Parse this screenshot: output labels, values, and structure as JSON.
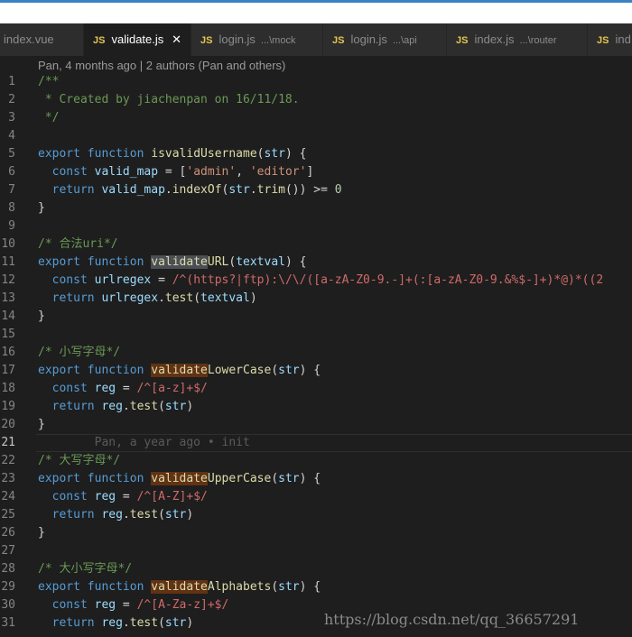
{
  "tabs": [
    {
      "name": "index.vue",
      "badge": "",
      "desc": "",
      "active": false,
      "closable": false
    },
    {
      "name": "validate.js",
      "badge": "JS",
      "desc": "",
      "active": true,
      "closable": true
    },
    {
      "name": "login.js",
      "badge": "JS",
      "desc": "...\\mock",
      "active": false,
      "closable": false
    },
    {
      "name": "login.js",
      "badge": "JS",
      "desc": "...\\api",
      "active": false,
      "closable": false
    },
    {
      "name": "index.js",
      "badge": "JS",
      "desc": "...\\router",
      "active": false,
      "closable": false
    },
    {
      "name": "ind",
      "badge": "JS",
      "desc": "",
      "active": false,
      "closable": false
    }
  ],
  "close_glyph": "✕",
  "blame": "Pan, 4 months ago | 2 authors (Pan and others)",
  "lines": [
    {
      "n": "1",
      "tokens": [
        {
          "t": "/**",
          "c": "comment"
        }
      ]
    },
    {
      "n": "2",
      "tokens": [
        {
          "t": " * Created by jiachenpan on 16/11/18.",
          "c": "comment"
        }
      ]
    },
    {
      "n": "3",
      "tokens": [
        {
          "t": " */",
          "c": "comment"
        }
      ]
    },
    {
      "n": "4",
      "tokens": []
    },
    {
      "n": "5",
      "tokens": [
        {
          "t": "export",
          "c": "keyword"
        },
        {
          "t": " ",
          "c": "plain"
        },
        {
          "t": "function",
          "c": "keyword"
        },
        {
          "t": " ",
          "c": "plain"
        },
        {
          "t": "isvalidUsername",
          "c": "fn"
        },
        {
          "t": "(",
          "c": "plain"
        },
        {
          "t": "str",
          "c": "var"
        },
        {
          "t": ") {",
          "c": "plain"
        }
      ]
    },
    {
      "n": "6",
      "tokens": [
        {
          "t": "  ",
          "c": "plain"
        },
        {
          "t": "const",
          "c": "keyword"
        },
        {
          "t": " ",
          "c": "plain"
        },
        {
          "t": "valid_map",
          "c": "var"
        },
        {
          "t": " = [",
          "c": "plain"
        },
        {
          "t": "'admin'",
          "c": "str"
        },
        {
          "t": ", ",
          "c": "plain"
        },
        {
          "t": "'editor'",
          "c": "str"
        },
        {
          "t": "]",
          "c": "plain"
        }
      ]
    },
    {
      "n": "7",
      "tokens": [
        {
          "t": "  ",
          "c": "plain"
        },
        {
          "t": "return",
          "c": "keyword"
        },
        {
          "t": " ",
          "c": "plain"
        },
        {
          "t": "valid_map",
          "c": "var"
        },
        {
          "t": ".",
          "c": "plain"
        },
        {
          "t": "indexOf",
          "c": "fn"
        },
        {
          "t": "(",
          "c": "plain"
        },
        {
          "t": "str",
          "c": "var"
        },
        {
          "t": ".",
          "c": "plain"
        },
        {
          "t": "trim",
          "c": "fn"
        },
        {
          "t": "()) >= ",
          "c": "plain"
        },
        {
          "t": "0",
          "c": "num"
        }
      ]
    },
    {
      "n": "8",
      "tokens": [
        {
          "t": "}",
          "c": "plain"
        }
      ]
    },
    {
      "n": "9",
      "tokens": []
    },
    {
      "n": "10",
      "tokens": [
        {
          "t": "/* 合法uri*/",
          "c": "comment"
        }
      ]
    },
    {
      "n": "11",
      "tokens": [
        {
          "t": "export",
          "c": "keyword"
        },
        {
          "t": " ",
          "c": "plain"
        },
        {
          "t": "function",
          "c": "keyword"
        },
        {
          "t": " ",
          "c": "plain"
        },
        {
          "t": "validate",
          "c": "fn hl"
        },
        {
          "t": "URL",
          "c": "fn"
        },
        {
          "t": "(",
          "c": "plain"
        },
        {
          "t": "textval",
          "c": "var"
        },
        {
          "t": ") {",
          "c": "plain"
        }
      ]
    },
    {
      "n": "12",
      "tokens": [
        {
          "t": "  ",
          "c": "plain"
        },
        {
          "t": "const",
          "c": "keyword"
        },
        {
          "t": " ",
          "c": "plain"
        },
        {
          "t": "urlregex",
          "c": "var"
        },
        {
          "t": " = ",
          "c": "plain"
        },
        {
          "t": "/^(https?|ftp):\\/\\/([a-zA-Z0-9.-]+(:[a-zA-Z0-9.&%$-]+)*@)*((2",
          "c": "regex"
        }
      ]
    },
    {
      "n": "13",
      "tokens": [
        {
          "t": "  ",
          "c": "plain"
        },
        {
          "t": "return",
          "c": "keyword"
        },
        {
          "t": " ",
          "c": "plain"
        },
        {
          "t": "urlregex",
          "c": "var"
        },
        {
          "t": ".",
          "c": "plain"
        },
        {
          "t": "test",
          "c": "fn"
        },
        {
          "t": "(",
          "c": "plain"
        },
        {
          "t": "textval",
          "c": "var"
        },
        {
          "t": ")",
          "c": "plain"
        }
      ]
    },
    {
      "n": "14",
      "tokens": [
        {
          "t": "}",
          "c": "plain"
        }
      ]
    },
    {
      "n": "15",
      "tokens": []
    },
    {
      "n": "16",
      "tokens": [
        {
          "t": "/* 小写字母*/",
          "c": "comment"
        }
      ]
    },
    {
      "n": "17",
      "tokens": [
        {
          "t": "export",
          "c": "keyword"
        },
        {
          "t": " ",
          "c": "plain"
        },
        {
          "t": "function",
          "c": "keyword"
        },
        {
          "t": " ",
          "c": "plain"
        },
        {
          "t": "validate",
          "c": "fn hl2"
        },
        {
          "t": "LowerCase",
          "c": "fn"
        },
        {
          "t": "(",
          "c": "plain"
        },
        {
          "t": "str",
          "c": "var"
        },
        {
          "t": ") {",
          "c": "plain"
        }
      ]
    },
    {
      "n": "18",
      "tokens": [
        {
          "t": "  ",
          "c": "plain"
        },
        {
          "t": "const",
          "c": "keyword"
        },
        {
          "t": " ",
          "c": "plain"
        },
        {
          "t": "reg",
          "c": "var"
        },
        {
          "t": " = ",
          "c": "plain"
        },
        {
          "t": "/^[a-z]+$/",
          "c": "regex"
        }
      ]
    },
    {
      "n": "19",
      "tokens": [
        {
          "t": "  ",
          "c": "plain"
        },
        {
          "t": "return",
          "c": "keyword"
        },
        {
          "t": " ",
          "c": "plain"
        },
        {
          "t": "reg",
          "c": "var"
        },
        {
          "t": ".",
          "c": "plain"
        },
        {
          "t": "test",
          "c": "fn"
        },
        {
          "t": "(",
          "c": "plain"
        },
        {
          "t": "str",
          "c": "var"
        },
        {
          "t": ")",
          "c": "plain"
        }
      ]
    },
    {
      "n": "20",
      "tokens": [
        {
          "t": "}",
          "c": "plain"
        }
      ]
    },
    {
      "n": "21",
      "cursor": true,
      "tokens": [
        {
          "t": "        Pan, a year ago • init",
          "c": "ghost"
        }
      ]
    },
    {
      "n": "22",
      "tokens": [
        {
          "t": "/* 大写字母*/",
          "c": "comment"
        }
      ]
    },
    {
      "n": "23",
      "tokens": [
        {
          "t": "export",
          "c": "keyword"
        },
        {
          "t": " ",
          "c": "plain"
        },
        {
          "t": "function",
          "c": "keyword"
        },
        {
          "t": " ",
          "c": "plain"
        },
        {
          "t": "validate",
          "c": "fn hl2"
        },
        {
          "t": "UpperCase",
          "c": "fn"
        },
        {
          "t": "(",
          "c": "plain"
        },
        {
          "t": "str",
          "c": "var"
        },
        {
          "t": ") {",
          "c": "plain"
        }
      ]
    },
    {
      "n": "24",
      "tokens": [
        {
          "t": "  ",
          "c": "plain"
        },
        {
          "t": "const",
          "c": "keyword"
        },
        {
          "t": " ",
          "c": "plain"
        },
        {
          "t": "reg",
          "c": "var"
        },
        {
          "t": " = ",
          "c": "plain"
        },
        {
          "t": "/^[A-Z]+$/",
          "c": "regex"
        }
      ]
    },
    {
      "n": "25",
      "tokens": [
        {
          "t": "  ",
          "c": "plain"
        },
        {
          "t": "return",
          "c": "keyword"
        },
        {
          "t": " ",
          "c": "plain"
        },
        {
          "t": "reg",
          "c": "var"
        },
        {
          "t": ".",
          "c": "plain"
        },
        {
          "t": "test",
          "c": "fn"
        },
        {
          "t": "(",
          "c": "plain"
        },
        {
          "t": "str",
          "c": "var"
        },
        {
          "t": ")",
          "c": "plain"
        }
      ]
    },
    {
      "n": "26",
      "tokens": [
        {
          "t": "}",
          "c": "plain"
        }
      ]
    },
    {
      "n": "27",
      "tokens": []
    },
    {
      "n": "28",
      "tokens": [
        {
          "t": "/* 大小写字母*/",
          "c": "comment"
        }
      ]
    },
    {
      "n": "29",
      "tokens": [
        {
          "t": "export",
          "c": "keyword"
        },
        {
          "t": " ",
          "c": "plain"
        },
        {
          "t": "function",
          "c": "keyword"
        },
        {
          "t": " ",
          "c": "plain"
        },
        {
          "t": "validate",
          "c": "fn hl2"
        },
        {
          "t": "Alphabets",
          "c": "fn"
        },
        {
          "t": "(",
          "c": "plain"
        },
        {
          "t": "str",
          "c": "var"
        },
        {
          "t": ") {",
          "c": "plain"
        }
      ]
    },
    {
      "n": "30",
      "tokens": [
        {
          "t": "  ",
          "c": "plain"
        },
        {
          "t": "const",
          "c": "keyword"
        },
        {
          "t": " ",
          "c": "plain"
        },
        {
          "t": "reg",
          "c": "var"
        },
        {
          "t": " = ",
          "c": "plain"
        },
        {
          "t": "/^[A-Za-z]+$/",
          "c": "regex"
        }
      ]
    },
    {
      "n": "31",
      "tokens": [
        {
          "t": "  ",
          "c": "plain"
        },
        {
          "t": "return",
          "c": "keyword"
        },
        {
          "t": " ",
          "c": "plain"
        },
        {
          "t": "reg",
          "c": "var"
        },
        {
          "t": ".",
          "c": "plain"
        },
        {
          "t": "test",
          "c": "fn"
        },
        {
          "t": "(",
          "c": "plain"
        },
        {
          "t": "str",
          "c": "var"
        },
        {
          "t": ")",
          "c": "plain"
        }
      ]
    }
  ],
  "watermark": "https://blog.csdn.net/qq_36657291"
}
